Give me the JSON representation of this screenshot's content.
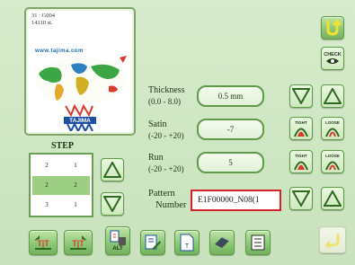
{
  "preview": {
    "line1": "31 : G004",
    "line2": "14110 st.",
    "url": "www.tajima.com",
    "logo_text": "TAJIMA"
  },
  "top_right": {
    "back_icon": "u-turn-arrow-icon",
    "check_label": "CHECK",
    "check_icon": "eye-icon"
  },
  "params": [
    {
      "label": "Thickness",
      "range": "(0.0 - 8.0)",
      "value": "0.5 mm"
    },
    {
      "label": "Satin",
      "range": "(-20 - +20)",
      "value": "-7"
    },
    {
      "label": "Run",
      "range": "(-20 - +20)",
      "value": "5"
    }
  ],
  "tight_label": "TIGHT",
  "loose_label": "LOOSE",
  "pattern": {
    "label_line1": "Pattern",
    "label_line2": "Number",
    "value": "E1F00000_N08(1"
  },
  "step": {
    "title": "STEP",
    "rows": [
      {
        "a": "2",
        "b": "1"
      },
      {
        "a": "2",
        "b": "2"
      },
      {
        "a": "3",
        "b": "1"
      }
    ],
    "selected_index": 1
  },
  "bottom_toolbar": {
    "alt_label": "ALT",
    "icons": [
      "tft-left-icon",
      "tft-right-icon",
      "alt-copy-delete-icon",
      "edit-note-icon",
      "page-t-icon",
      "eraser-icon",
      "list-icon",
      "confirm-arrow-icon"
    ]
  },
  "colors": {
    "panel": "#cfe6c4",
    "button": "#8cc877",
    "pattern_border": "#d4232a",
    "confirm_disabled": "#f0e170"
  }
}
